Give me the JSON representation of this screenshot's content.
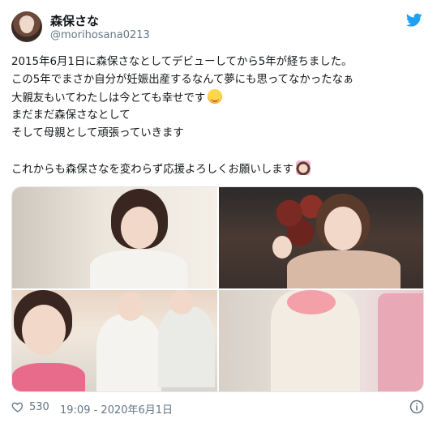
{
  "tweet": {
    "display_name": "森保さな",
    "handle": "@morihosana0213",
    "lines": [
      "2015年6月1日に森保さなとしてデビューしてから5年が経ちました。",
      "この5年でまさか自分が妊娠出産するなんて夢にも思ってなかったなぁ",
      "大親友もいてわたしは今とても幸せです",
      "まだまだ森保さなとして",
      "そして母親として頑張っていきます",
      "",
      "これからも森保さなを変わらず応援よろしくお願いします"
    ],
    "emojis": {
      "line3": "smiling-face-emoji",
      "line7": "person-bowing-emoji"
    },
    "likes": "530",
    "timestamp": "19:09 - 2020年6月1日"
  },
  "colors": {
    "twitter_blue": "#1da1f2",
    "text_primary": "#14171a",
    "text_secondary": "#657786",
    "border": "#e1e8ed"
  },
  "icons": {
    "brand": "twitter-bird-icon",
    "like": "heart-icon",
    "info": "info-icon"
  }
}
